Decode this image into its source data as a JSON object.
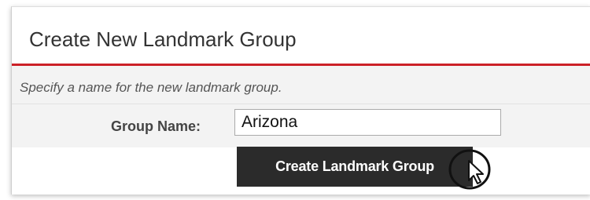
{
  "dialog": {
    "title": "Create New Landmark Group",
    "instructions": "Specify a name for the new landmark group.",
    "group_name_label": "Group Name:",
    "group_name_value": "Arizona",
    "create_button_label": "Create Landmark Group"
  },
  "colors": {
    "accent_red": "#cc2027",
    "button_dark": "#2b2b2b",
    "form_background": "#f3f3f3"
  },
  "icons": {
    "cursor": "mouse-pointer-icon"
  }
}
